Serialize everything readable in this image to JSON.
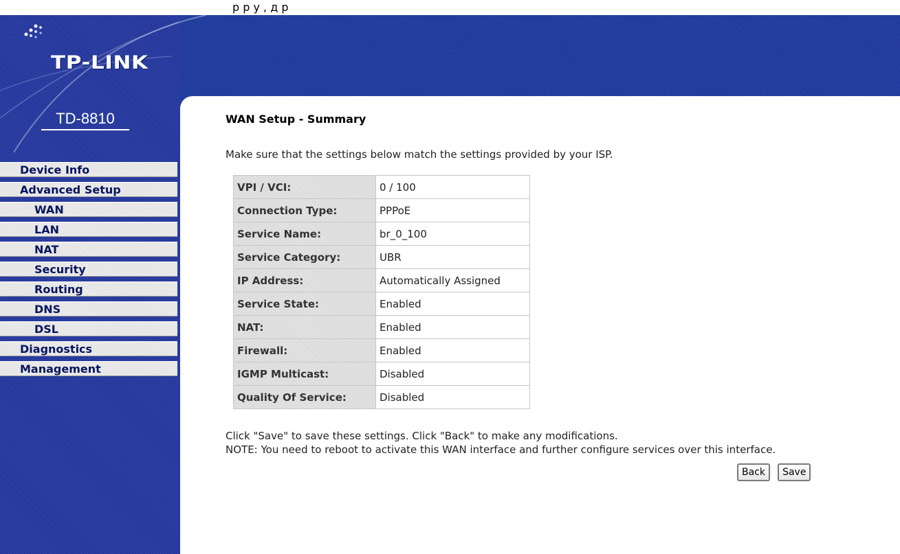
{
  "top_strip": {
    "text": "р  р у      , д                                     р"
  },
  "brand": {
    "logo_text": "TP-LINK",
    "model": "TD-8810"
  },
  "menu": {
    "items": [
      {
        "label": "Device Info",
        "level": "top"
      },
      {
        "label": "Advanced Setup",
        "level": "top"
      },
      {
        "label": "WAN",
        "level": "sub"
      },
      {
        "label": "LAN",
        "level": "sub"
      },
      {
        "label": "NAT",
        "level": "sub"
      },
      {
        "label": "Security",
        "level": "sub"
      },
      {
        "label": "Routing",
        "level": "sub"
      },
      {
        "label": "DNS",
        "level": "sub"
      },
      {
        "label": "DSL",
        "level": "sub"
      },
      {
        "label": "Diagnostics",
        "level": "top"
      },
      {
        "label": "Management",
        "level": "top"
      }
    ]
  },
  "main": {
    "title": "WAN Setup - Summary",
    "intro": "Make sure that the settings below match the settings provided by your ISP.",
    "table": [
      {
        "label": "VPI / VCI:",
        "value": "0 / 100"
      },
      {
        "label": "Connection Type:",
        "value": "PPPoE"
      },
      {
        "label": "Service Name:",
        "value": "br_0_100"
      },
      {
        "label": "Service Category:",
        "value": "UBR"
      },
      {
        "label": "IP Address:",
        "value": "Automatically Assigned"
      },
      {
        "label": "Service State:",
        "value": "Enabled"
      },
      {
        "label": "NAT:",
        "value": "Enabled"
      },
      {
        "label": "Firewall:",
        "value": "Enabled"
      },
      {
        "label": "IGMP Multicast:",
        "value": "Disabled"
      },
      {
        "label": "Quality Of Service:",
        "value": "Disabled"
      }
    ],
    "note_line1": "Click \"Save\" to save these settings. Click \"Back\" to make any modifications.",
    "note_line2": "NOTE: You need to reboot to activate this WAN interface and further configure services over this interface.",
    "back_label": "Back",
    "save_label": "Save"
  },
  "colors": {
    "header_blue": "#1f3ba0",
    "menu_text": "#07155e",
    "menu_bg": "#ececec"
  }
}
